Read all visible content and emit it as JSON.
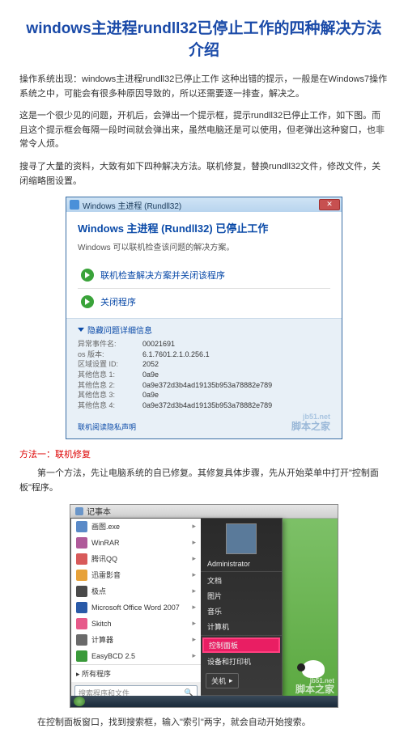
{
  "title": "windows主进程rundll32已停止工作的四种解决方法介绍",
  "para1": "操作系统出现：windows主进程rundll32已停止工作 这种出错的提示，一般是在Windows7操作系统之中，可能会有很多种原因导致的，所以还需要逐一排查，解决之。",
  "para2": "这是一个很少见的问题，开机后，会弹出一个提示框，提示rundll32已停止工作，如下图。而且这个提示框会每隔一段时间就会弹出来，虽然电脑还是可以使用，但老弹出这种窗口，也非常令人烦。",
  "para3": "搜寻了大量的资料，大致有如下四种解决方法。联机修复，替换rundll32文件，修改文件，关闭缩略图设置。",
  "method1_heading": "方法一：联机修复",
  "method1_step1": "第一个方法，先让电脑系统的自已修复。其修复具体步骤，先从开始菜单中打开\"控制面板\"程序。",
  "method1_step2": "在控制面板窗口，找到搜索框，输入\"索引\"两字，就会自动开始搜索。",
  "shot1": {
    "window_title": "Windows 主进程 (Rundll32)",
    "heading": "Windows 主进程 (Rundll32) 已停止工作",
    "subheading": "Windows 可以联机检查该问题的解决方案。",
    "action1": "联机检查解决方案并关闭该程序",
    "action2": "关闭程序",
    "details_toggle": "隐藏问题详细信息",
    "kv": [
      {
        "k": "异常事件名:",
        "v": "00021691"
      },
      {
        "k": "os 版本:",
        "v": "6.1.7601.2.1.0.256.1"
      },
      {
        "k": "区域设置 ID:",
        "v": "2052"
      },
      {
        "k": "其他信息 1:",
        "v": "0a9e"
      },
      {
        "k": "其他信息 2:",
        "v": "0a9e372d3b4ad19135b953a78882e789"
      },
      {
        "k": "其他信息 3:",
        "v": "0a9e"
      },
      {
        "k": "其他信息 4:",
        "v": "0a9e372d3b4ad19135b953a78882e789"
      }
    ],
    "privacy": "联机阅读隐私声明",
    "brand_top": "jb51.net",
    "brand": "脚本之家"
  },
  "shot2": {
    "topbar_label": "记事本",
    "left_items": [
      {
        "label": "画图.exe",
        "c": "#5a8ac8"
      },
      {
        "label": "WinRAR",
        "c": "#b05a9a"
      },
      {
        "label": "腾讯QQ",
        "c": "#d85a5a"
      },
      {
        "label": "迅雷影音",
        "c": "#e7a23a"
      },
      {
        "label": "极点",
        "c": "#4a4a4a"
      },
      {
        "label": "Microsoft Office Word 2007",
        "c": "#2a5aa8"
      },
      {
        "label": "Skitch",
        "c": "#e75a8a"
      },
      {
        "label": "计算器",
        "c": "#6a6a6a"
      },
      {
        "label": "EasyBCD 2.5",
        "c": "#3a9a3a"
      }
    ],
    "all_programs": "所有程序",
    "search_placeholder": "搜索程序和文件",
    "admin": "Administrator",
    "right_items": [
      "文档",
      "图片",
      "音乐",
      "计算机"
    ],
    "highlight": "控制面板",
    "right_items2": [
      "设备和打印机"
    ],
    "shutdown": "关机",
    "brand_top": "jb51.net",
    "brand": "脚本之家"
  }
}
